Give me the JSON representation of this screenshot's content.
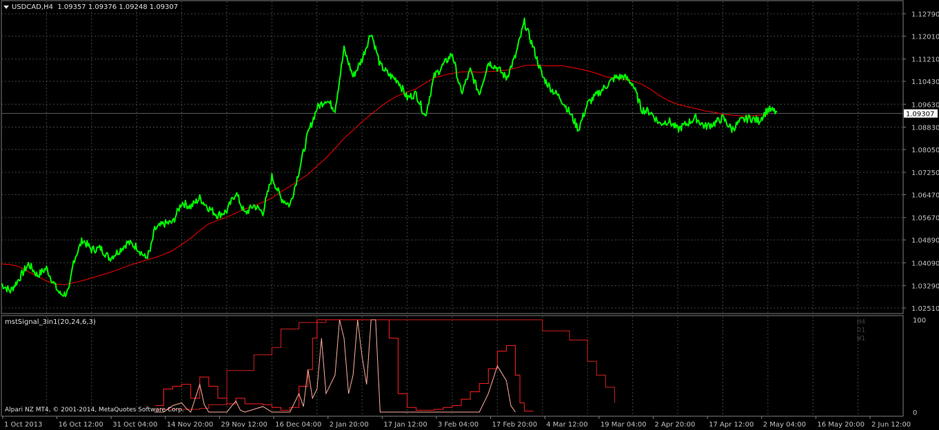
{
  "header": {
    "symbol": "USDCAD,H4",
    "ohlc": "1.09357 1.09376 1.09248 1.09307"
  },
  "indicator": {
    "label": "mstSignal_3in1(20,24,6,3)",
    "timeframes": [
      "H4",
      "D1",
      "W1"
    ]
  },
  "copyright": "Alpari NZ MT4, © 2001-2014, MetaQuotes Software Corp.",
  "colors": {
    "background": "#000000",
    "grid": "#3a4a3a",
    "price": "#00ff00",
    "ma": "#ff0000",
    "axis_text": "#c0c0c0",
    "ind_h4": "#ffb0a0",
    "ind_d1": "#ff2020",
    "ind_w1": "#d02020"
  },
  "chart_data": [
    {
      "type": "line",
      "name": "price",
      "yticks": [
        "1.12790",
        "1.12010",
        "1.11210",
        "1.10430",
        "1.09630",
        "1.08830",
        "1.08050",
        "1.07250",
        "1.06470",
        "1.05670",
        "1.04890",
        "1.04090",
        "1.03290",
        "1.02510"
      ],
      "ytick_values": [
        1.1279,
        1.1201,
        1.1121,
        1.1043,
        1.0963,
        1.0883,
        1.0805,
        1.0725,
        1.0647,
        1.0567,
        1.0489,
        1.0409,
        1.0329,
        1.0251
      ],
      "ylim": [
        1.0251,
        1.1279
      ],
      "current_price": "1.09307",
      "current_value": 1.09307,
      "xlabels": [
        "1 Oct 2013",
        "16 Oct 12:00",
        "31 Oct 04:00",
        "14 Nov 20:00",
        "29 Nov 12:00",
        "16 Dec 04:00",
        "2 Jan 20:00",
        "17 Jan 12:00",
        "3 Feb 04:00",
        "17 Feb 20:00",
        "4 Mar 12:00",
        "19 Mar 04:00",
        "2 Apr 20:00",
        "17 Apr 12:00",
        "2 May 04:00",
        "16 May 20:00",
        "2 Jun 12:00"
      ],
      "xlim": [
        0,
        100
      ],
      "price_series": [
        [
          0,
          1.0335
        ],
        [
          1,
          1.031
        ],
        [
          2,
          1.0355
        ],
        [
          3,
          1.0405
        ],
        [
          4,
          1.0365
        ],
        [
          5,
          1.039
        ],
        [
          6,
          1.0325
        ],
        [
          6.5,
          1.03
        ],
        [
          7,
          1.03
        ],
        [
          7.5,
          1.031
        ],
        [
          8,
          1.0415
        ],
        [
          9,
          1.049
        ],
        [
          10,
          1.0455
        ],
        [
          11,
          1.046
        ],
        [
          12,
          1.0425
        ],
        [
          13,
          1.045
        ],
        [
          14,
          1.048
        ],
        [
          15,
          1.0465
        ],
        [
          16,
          1.0425
        ],
        [
          16.5,
          1.045
        ],
        [
          17,
          1.0525
        ],
        [
          18,
          1.0545
        ],
        [
          19,
          1.055
        ],
        [
          20,
          1.062
        ],
        [
          21,
          1.0605
        ],
        [
          22,
          1.0635
        ],
        [
          23,
          1.06
        ],
        [
          24,
          1.0575
        ],
        [
          25,
          1.059
        ],
        [
          26,
          1.0655
        ],
        [
          27,
          1.058
        ],
        [
          28,
          1.061
        ],
        [
          29,
          1.0585
        ],
        [
          30,
          1.071
        ],
        [
          31,
          1.0635
        ],
        [
          32,
          1.061
        ],
        [
          33,
          1.073
        ],
        [
          34,
          1.086
        ],
        [
          35,
          1.095
        ],
        [
          36,
          1.098
        ],
        [
          37,
          1.0945
        ],
        [
          38,
          1.1155
        ],
        [
          39,
          1.106
        ],
        [
          40,
          1.112
        ],
        [
          41,
          1.1215
        ],
        [
          42,
          1.11
        ],
        [
          43,
          1.1065
        ],
        [
          44,
          1.1045
        ],
        [
          45,
          1.0985
        ],
        [
          46,
          1.1
        ],
        [
          47,
          1.092
        ],
        [
          48,
          1.106
        ],
        [
          49,
          1.11
        ],
        [
          50,
          1.114
        ],
        [
          51,
          1.1
        ],
        [
          52,
          1.108
        ],
        [
          53,
          1.1
        ],
        [
          54,
          1.111
        ],
        [
          55,
          1.109
        ],
        [
          56,
          1.1055
        ],
        [
          57,
          1.113
        ],
        [
          58,
          1.125
        ],
        [
          59,
          1.116
        ],
        [
          60,
          1.106
        ],
        [
          61,
          1.1015
        ],
        [
          62,
          1.0985
        ],
        [
          63,
          1.0935
        ],
        [
          64,
          1.0875
        ],
        [
          65,
          1.0965
        ],
        [
          66,
          1.0995
        ],
        [
          67,
          1.1025
        ],
        [
          68,
          1.1055
        ],
        [
          69,
          1.106
        ],
        [
          70,
          1.1035
        ],
        [
          71,
          1.0945
        ],
        [
          72,
          1.0935
        ],
        [
          73,
          1.0895
        ],
        [
          74,
          1.0905
        ],
        [
          75,
          1.0875
        ],
        [
          76,
          1.0895
        ],
        [
          77,
          1.0915
        ],
        [
          78,
          1.0885
        ],
        [
          79,
          1.0895
        ],
        [
          80,
          1.0915
        ],
        [
          81,
          1.0875
        ],
        [
          82,
          1.0905
        ],
        [
          83,
          1.0915
        ],
        [
          84,
          1.0905
        ],
        [
          85,
          1.0945
        ],
        [
          86,
          1.0935
        ]
      ],
      "ma_series": [
        [
          0,
          1.0405
        ],
        [
          1,
          1.0403
        ],
        [
          2,
          1.0395
        ],
        [
          3,
          1.0378
        ],
        [
          4,
          1.0362
        ],
        [
          5,
          1.0345
        ],
        [
          6,
          1.0335
        ],
        [
          7,
          1.0333
        ],
        [
          8,
          1.0339
        ],
        [
          9,
          1.0347
        ],
        [
          10,
          1.0356
        ],
        [
          11,
          1.0365
        ],
        [
          12,
          1.0375
        ],
        [
          13,
          1.0386
        ],
        [
          14,
          1.0398
        ],
        [
          15,
          1.0408
        ],
        [
          16,
          1.0418
        ],
        [
          17,
          1.0427
        ],
        [
          18,
          1.0438
        ],
        [
          19,
          1.0452
        ],
        [
          20,
          1.0473
        ],
        [
          21,
          1.0495
        ],
        [
          22,
          1.0522
        ],
        [
          23,
          1.0545
        ],
        [
          24,
          1.0558
        ],
        [
          25,
          1.0568
        ],
        [
          26,
          1.0583
        ],
        [
          27,
          1.0597
        ],
        [
          28,
          1.0608
        ],
        [
          29,
          1.062
        ],
        [
          30,
          1.0636
        ],
        [
          31,
          1.0657
        ],
        [
          32,
          1.0676
        ],
        [
          33,
          1.0697
        ],
        [
          34,
          1.0718
        ],
        [
          35,
          1.0747
        ],
        [
          36,
          1.0775
        ],
        [
          37,
          1.0808
        ],
        [
          38,
          1.0844
        ],
        [
          39,
          1.0872
        ],
        [
          40,
          1.0902
        ],
        [
          41,
          1.0928
        ],
        [
          42,
          1.0953
        ],
        [
          43,
          1.0976
        ],
        [
          44,
          1.0993
        ],
        [
          45,
          1.1005
        ],
        [
          46,
          1.1017
        ],
        [
          47,
          1.1037
        ],
        [
          48,
          1.1055
        ],
        [
          49,
          1.1064
        ],
        [
          50,
          1.1071
        ],
        [
          51,
          1.1076
        ],
        [
          52,
          1.1077
        ],
        [
          53,
          1.1074
        ],
        [
          54,
          1.1077
        ],
        [
          55,
          1.1079
        ],
        [
          56,
          1.1082
        ],
        [
          57,
          1.1089
        ],
        [
          58,
          1.1098
        ],
        [
          59,
          1.11
        ],
        [
          60,
          1.1098
        ],
        [
          61,
          1.1097
        ],
        [
          62,
          1.1098
        ],
        [
          63,
          1.1093
        ],
        [
          64,
          1.1087
        ],
        [
          65,
          1.108
        ],
        [
          66,
          1.1071
        ],
        [
          67,
          1.1059
        ],
        [
          68,
          1.1055
        ],
        [
          69,
          1.1049
        ],
        [
          70,
          1.1045
        ],
        [
          71,
          1.1033
        ],
        [
          72,
          1.1015
        ],
        [
          73,
          1.0993
        ],
        [
          74,
          1.0975
        ],
        [
          75,
          1.0963
        ],
        [
          76,
          1.0955
        ],
        [
          77,
          1.0948
        ],
        [
          78,
          1.094
        ],
        [
          79,
          1.0935
        ],
        [
          80,
          1.0928
        ],
        [
          81,
          1.0925
        ],
        [
          82,
          1.0922
        ],
        [
          83,
          1.0922
        ],
        [
          84,
          1.0925
        ],
        [
          85,
          1.0927
        ]
      ]
    },
    {
      "type": "line",
      "name": "mstSignal_3in1(20,24,6,3)",
      "yticks": [
        "100",
        "0"
      ],
      "ylim": [
        0,
        100
      ],
      "xlim": [
        0,
        100
      ],
      "series_h4": [
        [
          17,
          0
        ],
        [
          18,
          0
        ],
        [
          19,
          7
        ],
        [
          20,
          10
        ],
        [
          20.5,
          4
        ],
        [
          21,
          0
        ],
        [
          22,
          30
        ],
        [
          22.5,
          8
        ],
        [
          23,
          0
        ],
        [
          25,
          0
        ],
        [
          26,
          12
        ],
        [
          26.5,
          2
        ],
        [
          27,
          0
        ],
        [
          29,
          6
        ],
        [
          30,
          0
        ],
        [
          32,
          0
        ],
        [
          33,
          20
        ],
        [
          33.5,
          6
        ],
        [
          34,
          46
        ],
        [
          34.5,
          15
        ],
        [
          35,
          25
        ],
        [
          35.5,
          80
        ],
        [
          36,
          20
        ],
        [
          37,
          40
        ],
        [
          37.5,
          100
        ],
        [
          38,
          80
        ],
        [
          38.5,
          20
        ],
        [
          39,
          40
        ],
        [
          39.5,
          100
        ],
        [
          40,
          60
        ],
        [
          40.5,
          30
        ],
        [
          41,
          100
        ],
        [
          41.5,
          100
        ],
        [
          42,
          0
        ],
        [
          53,
          0
        ],
        [
          54,
          20
        ],
        [
          55,
          50
        ],
        [
          56,
          34
        ],
        [
          56.5,
          7
        ],
        [
          57,
          0
        ]
      ],
      "series_d1": [
        [
          17,
          7
        ],
        [
          18,
          25
        ],
        [
          19,
          28
        ],
        [
          20,
          30
        ],
        [
          21,
          15
        ],
        [
          22,
          38
        ],
        [
          23,
          28
        ],
        [
          24,
          15
        ],
        [
          25,
          9
        ],
        [
          26,
          15
        ],
        [
          27,
          9
        ],
        [
          28,
          9
        ],
        [
          29,
          8
        ],
        [
          30,
          5
        ],
        [
          31,
          2
        ],
        [
          32,
          5
        ],
        [
          33,
          28
        ],
        [
          34,
          46
        ],
        [
          34.5,
          80
        ],
        [
          35,
          100
        ],
        [
          36,
          100
        ],
        [
          37,
          100
        ],
        [
          38,
          100
        ],
        [
          39,
          100
        ],
        [
          40,
          100
        ],
        [
          41,
          100
        ],
        [
          42,
          100
        ],
        [
          43,
          80
        ],
        [
          44,
          20
        ],
        [
          45,
          5
        ],
        [
          46,
          2
        ],
        [
          48,
          3
        ],
        [
          49,
          5
        ],
        [
          50,
          7
        ],
        [
          51,
          14
        ],
        [
          52,
          22
        ],
        [
          53,
          31
        ],
        [
          54,
          47
        ],
        [
          55,
          66
        ],
        [
          56,
          72
        ],
        [
          57,
          40
        ],
        [
          57.5,
          10
        ],
        [
          58,
          1
        ],
        [
          59,
          1
        ]
      ],
      "series_w1": [
        [
          17,
          3
        ],
        [
          22,
          4
        ],
        [
          23,
          8
        ],
        [
          25,
          45
        ],
        [
          28,
          62
        ],
        [
          30,
          70
        ],
        [
          31,
          90
        ],
        [
          33,
          97
        ],
        [
          36,
          100
        ],
        [
          50,
          100
        ],
        [
          57,
          100
        ],
        [
          60,
          88
        ],
        [
          62,
          88
        ],
        [
          63,
          78
        ],
        [
          65,
          55
        ],
        [
          66,
          40
        ],
        [
          67,
          27
        ],
        [
          68,
          10
        ]
      ]
    }
  ]
}
